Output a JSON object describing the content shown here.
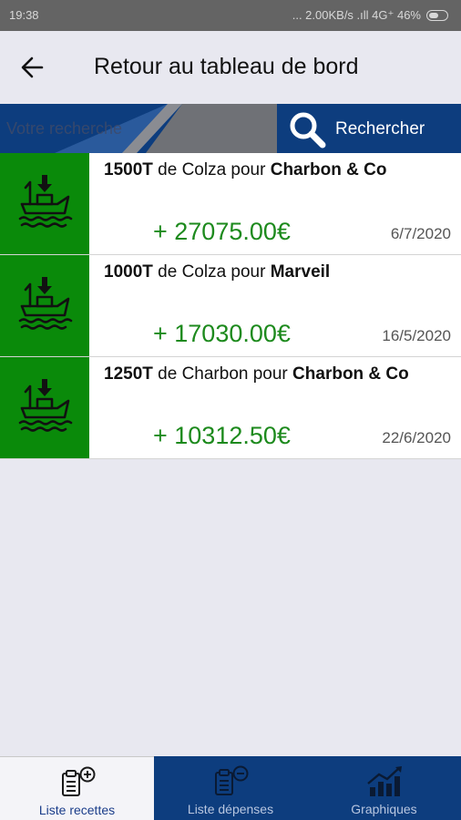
{
  "status_bar": {
    "time": "19:38",
    "indicators": "... 2.00KB/s .ıll 4G⁺ 46%"
  },
  "header": {
    "back_icon": "arrow-left-icon",
    "title": "Retour au tableau de bord"
  },
  "search": {
    "placeholder": "Votre recherche",
    "button_label": "Rechercher",
    "icon": "search-icon"
  },
  "items": [
    {
      "qty": "1500T",
      "mid": " de Colza pour ",
      "client": "Charbon & Co",
      "amount": "+ 27075.00€",
      "date": "6/7/2020",
      "icon": "ship-unload-icon"
    },
    {
      "qty": "1000T",
      "mid": " de Colza pour ",
      "client": "Marveil",
      "amount": "+ 17030.00€",
      "date": "16/5/2020",
      "icon": "ship-unload-icon"
    },
    {
      "qty": "1250T",
      "mid": " de Charbon pour ",
      "client": "Charbon & Co",
      "amount": "+ 10312.50€",
      "date": "22/6/2020",
      "icon": "ship-unload-icon"
    }
  ],
  "nav": {
    "tabs": [
      {
        "label": "Liste recettes",
        "icon": "clipboard-plus-icon",
        "active": true
      },
      {
        "label": "Liste dépenses",
        "icon": "clipboard-minus-icon",
        "active": false
      },
      {
        "label": "Graphiques",
        "icon": "bar-chart-trend-icon",
        "active": false
      }
    ]
  },
  "colors": {
    "accent_blue": "#0d3d7e",
    "income_green": "#0a8a0a",
    "amount_green": "#1d8a1d",
    "background": "#e8e8f0"
  }
}
